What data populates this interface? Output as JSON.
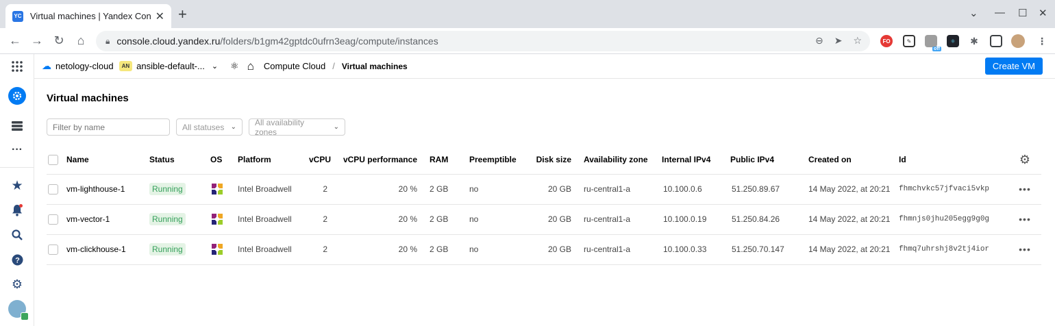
{
  "browser": {
    "tab_title": "Virtual machines | Yandex Cons",
    "favicon_text": "YC",
    "url_host": "console.cloud.yandex.ru",
    "url_path": "/folders/b1gm42gptdc0ufrn3eag/compute/instances",
    "ext_badge": "off",
    "ext_fo": "FO"
  },
  "topbar": {
    "cloud": "netology-cloud",
    "folder_badge": "AN",
    "folder": "ansible-default-...",
    "service": "Compute Cloud",
    "page": "Virtual machines",
    "create_label": "Create VM"
  },
  "main": {
    "title": "Virtual machines",
    "filter_placeholder": "Filter by name",
    "status_select": "All statuses",
    "zone_select": "All availability zones"
  },
  "table": {
    "headers": {
      "name": "Name",
      "status": "Status",
      "os": "OS",
      "platform": "Platform",
      "vcpu": "vCPU",
      "vcpu_perf": "vCPU performance",
      "ram": "RAM",
      "preemptible": "Preemptible",
      "disk": "Disk size",
      "zone": "Availability zone",
      "internal": "Internal IPv4",
      "public": "Public IPv4",
      "created": "Created on",
      "id": "Id"
    },
    "rows": [
      {
        "name": "vm-lighthouse-1",
        "status": "Running",
        "platform": "Intel Broadwell",
        "vcpu": "2",
        "perf": "20 %",
        "ram": "2 GB",
        "preemptible": "no",
        "disk": "20 GB",
        "zone": "ru-central1-a",
        "internal": "10.100.0.6",
        "public": "51.250.89.67",
        "created": "14 May 2022, at 20:21",
        "id": "fhmchvkc57jfvaci5vkp"
      },
      {
        "name": "vm-vector-1",
        "status": "Running",
        "platform": "Intel Broadwell",
        "vcpu": "2",
        "perf": "20 %",
        "ram": "2 GB",
        "preemptible": "no",
        "disk": "20 GB",
        "zone": "ru-central1-a",
        "internal": "10.100.0.19",
        "public": "51.250.84.26",
        "created": "14 May 2022, at 20:21",
        "id": "fhmnjs0jhu205egg9g0g"
      },
      {
        "name": "vm-clickhouse-1",
        "status": "Running",
        "platform": "Intel Broadwell",
        "vcpu": "2",
        "perf": "20 %",
        "ram": "2 GB",
        "preemptible": "no",
        "disk": "20 GB",
        "zone": "ru-central1-a",
        "internal": "10.100.0.33",
        "public": "51.250.70.147",
        "created": "14 May 2022, at 20:21",
        "id": "fhmq7uhrshj8v2tj4ior"
      }
    ]
  },
  "colors": {
    "accent": "#027bf3",
    "status_bg": "#e4f3e5",
    "status_fg": "#35a05a"
  }
}
